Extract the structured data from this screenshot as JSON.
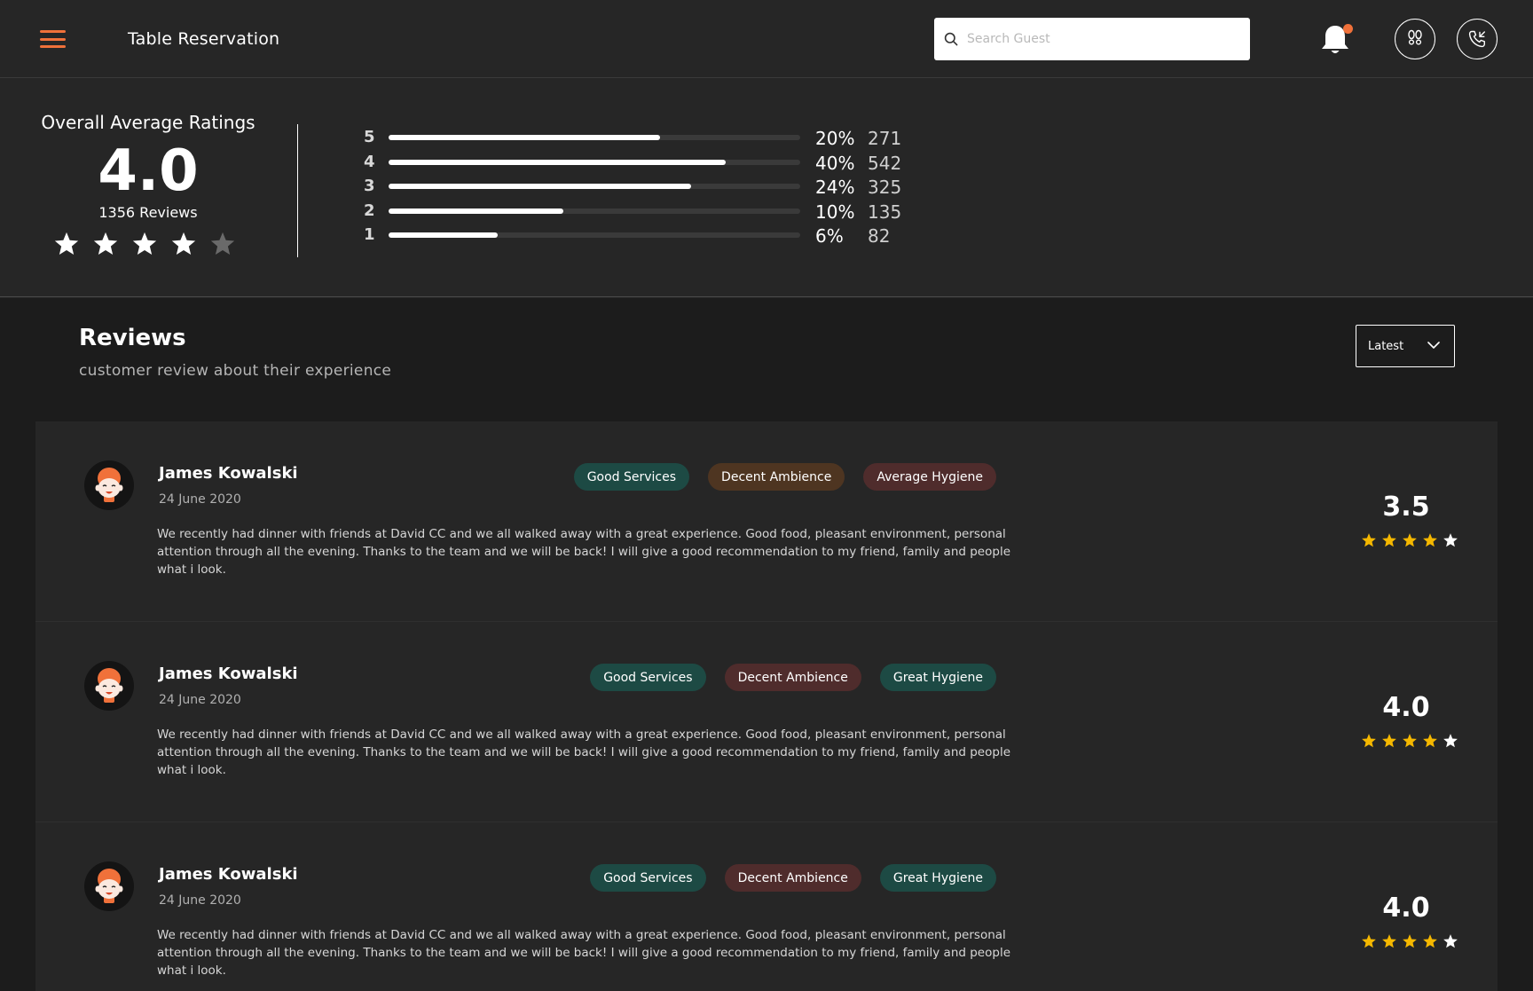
{
  "header": {
    "title": "Table Reservation",
    "search_placeholder": "Search Guest",
    "icons": {
      "menu": "hamburger-menu-icon",
      "bell": "bell-icon",
      "walk_in": "footprints-icon",
      "call": "phone-call-icon"
    }
  },
  "colors": {
    "accent": "#f0713a",
    "star_gold": "#f5b800",
    "tag_green": "#1d4a44",
    "tag_brown": "#4e3521",
    "tag_red": "#4f2c2c",
    "background": "#262626"
  },
  "ratings_summary": {
    "label": "Overall Average Ratings",
    "average": "4.0",
    "reviews_count": "1356 Reviews",
    "stars_filled": 4,
    "stars_total": 5,
    "distribution": [
      {
        "star": "5",
        "fill_fraction": 0.66,
        "percent": "20%",
        "count": "271"
      },
      {
        "star": "4",
        "fill_fraction": 0.82,
        "percent": "40%",
        "count": "542"
      },
      {
        "star": "3",
        "fill_fraction": 0.735,
        "percent": "24%",
        "count": "325"
      },
      {
        "star": "2",
        "fill_fraction": 0.425,
        "percent": "10%",
        "count": "135"
      },
      {
        "star": "1",
        "fill_fraction": 0.265,
        "percent": "6%",
        "count": "82"
      }
    ]
  },
  "reviews": {
    "title": "Reviews",
    "subtitle": "customer review about their experience",
    "sort_label": "Latest",
    "items": [
      {
        "name": "James Kowalski",
        "date": "24 June 2020",
        "tags": [
          {
            "label": "Good Services",
            "tone": "green"
          },
          {
            "label": "Decent Ambience",
            "tone": "brown"
          },
          {
            "label": "Average Hygiene",
            "tone": "red"
          }
        ],
        "text": "We recently had dinner with friends at David CC and we all walked away with a great experience. Good food, pleasant environment, personal attention through all the evening. Thanks to the team and we will be back!  I will give a good recommendation to my friend, family and people what i look.",
        "score": "3.5",
        "stars_gold": 4
      },
      {
        "name": "James Kowalski",
        "date": "24 June 2020",
        "tags": [
          {
            "label": "Good Services",
            "tone": "green"
          },
          {
            "label": "Decent Ambience",
            "tone": "red"
          },
          {
            "label": "Great Hygiene",
            "tone": "green"
          }
        ],
        "text": "We recently had dinner with friends at David CC and we all walked away with a great experience. Good food, pleasant environment, personal attention through all the evening. Thanks to the team and we will be back!  I will give a good recommendation to my friend, family and people what i look.",
        "score": "4.0",
        "stars_gold": 4
      },
      {
        "name": "James Kowalski",
        "date": "24 June 2020",
        "tags": [
          {
            "label": "Good Services",
            "tone": "green"
          },
          {
            "label": "Decent Ambience",
            "tone": "red"
          },
          {
            "label": "Great Hygiene",
            "tone": "green"
          }
        ],
        "text": "We recently had dinner with friends at David CC and we all walked away with a great experience. Good food, pleasant environment, personal attention through all the evening. Thanks to the team and we will be back!  I will give a good recommendation to my friend, family and people what i look.",
        "score": "4.0",
        "stars_gold": 4
      }
    ]
  }
}
